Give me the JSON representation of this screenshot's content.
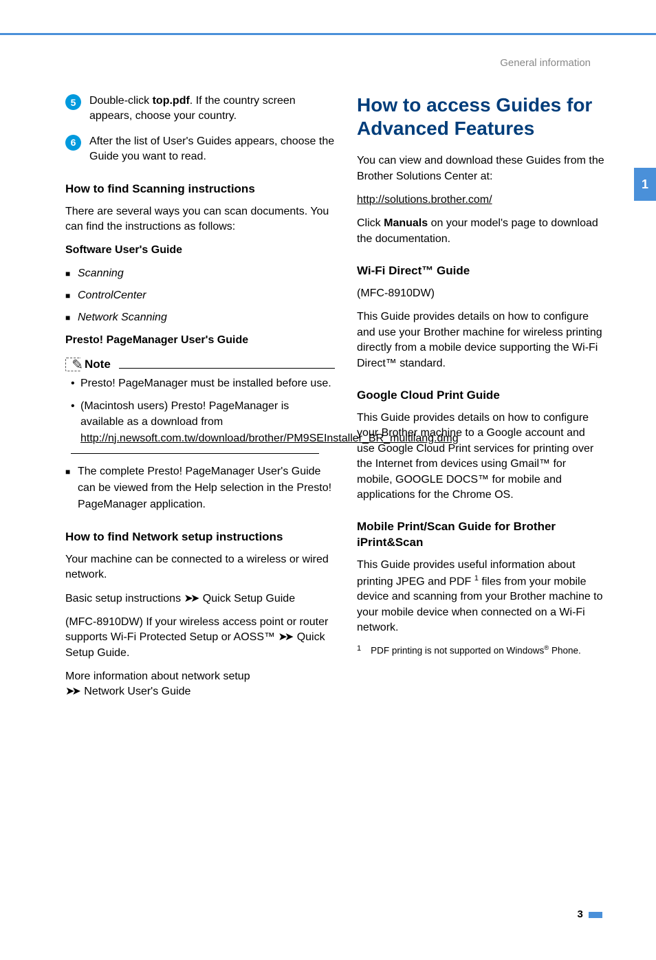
{
  "header": {
    "label": "General information"
  },
  "tab": {
    "number": "1"
  },
  "left": {
    "steps": [
      {
        "num": "5",
        "pre": "Double-click ",
        "bold": "top.pdf",
        "post": ". If the country screen appears, choose your country."
      },
      {
        "num": "6",
        "text": "After the list of User's Guides appears, choose the Guide you want to read."
      }
    ],
    "scan_heading": "How to find Scanning instructions",
    "scan_intro": "There are several ways you can scan documents. You can find the instructions as follows:",
    "sug_label": "Software User's Guide",
    "sug_items": [
      "Scanning",
      "ControlCenter",
      "Network Scanning"
    ],
    "presto_label": "Presto! PageManager User's Guide",
    "note_title": "Note",
    "note_items": [
      {
        "text": "Presto! PageManager must be installed before use."
      },
      {
        "text_pre": "(Macintosh users) Presto! PageManager is available as a download from ",
        "link": "http://nj.newsoft.com.tw/download/brother/PM9SEInstaller_BR_multilang.dmg"
      }
    ],
    "presto_complete": "The complete Presto! PageManager User's Guide can be viewed from the Help selection in the Presto! PageManager application.",
    "net_heading": "How to find Network setup instructions",
    "net_p1": "Your machine can be connected to a wireless or wired network.",
    "net_p2_pre": "Basic setup instructions ",
    "net_p2_post": " Quick Setup Guide",
    "net_p3_pre": "(MFC-8910DW) If your wireless access point or router supports Wi-Fi Protected Setup or AOSS™ ",
    "net_p3_post": " Quick Setup Guide.",
    "net_p4_pre": "More information about network setup ",
    "net_p4_post": " Network User's Guide"
  },
  "right": {
    "main_heading": "How to access Guides for Advanced Features",
    "intro": "You can view and download these Guides from the Brother Solutions Center at:",
    "link": "http://solutions.brother.com/",
    "click_pre": "Click ",
    "click_bold": "Manuals",
    "click_post": " on your model's page to download the documentation.",
    "wifi_heading": "Wi-Fi Direct™ Guide",
    "wifi_model": "(MFC-8910DW)",
    "wifi_body": "This Guide provides details on how to configure and use your Brother machine for wireless printing directly from a mobile device supporting the Wi-Fi Direct™ standard.",
    "gcp_heading": "Google Cloud Print Guide",
    "gcp_body": "This Guide provides details on how to configure your Brother machine to a Google account and use Google Cloud Print services for printing over the Internet from devices using Gmail™ for mobile, GOOGLE DOCS™ for mobile and applications for the Chrome OS.",
    "mobile_heading": "Mobile Print/Scan Guide for Brother iPrint&Scan",
    "mobile_body_pre": "This Guide provides useful information about printing JPEG and PDF ",
    "mobile_body_post": " files from your mobile device and scanning from your Brother machine to your mobile device when connected on a Wi-Fi network.",
    "footnote_num": "1",
    "footnote_text_pre": "PDF printing is not supported on Windows",
    "footnote_text_post": " Phone."
  },
  "page_number": "3"
}
